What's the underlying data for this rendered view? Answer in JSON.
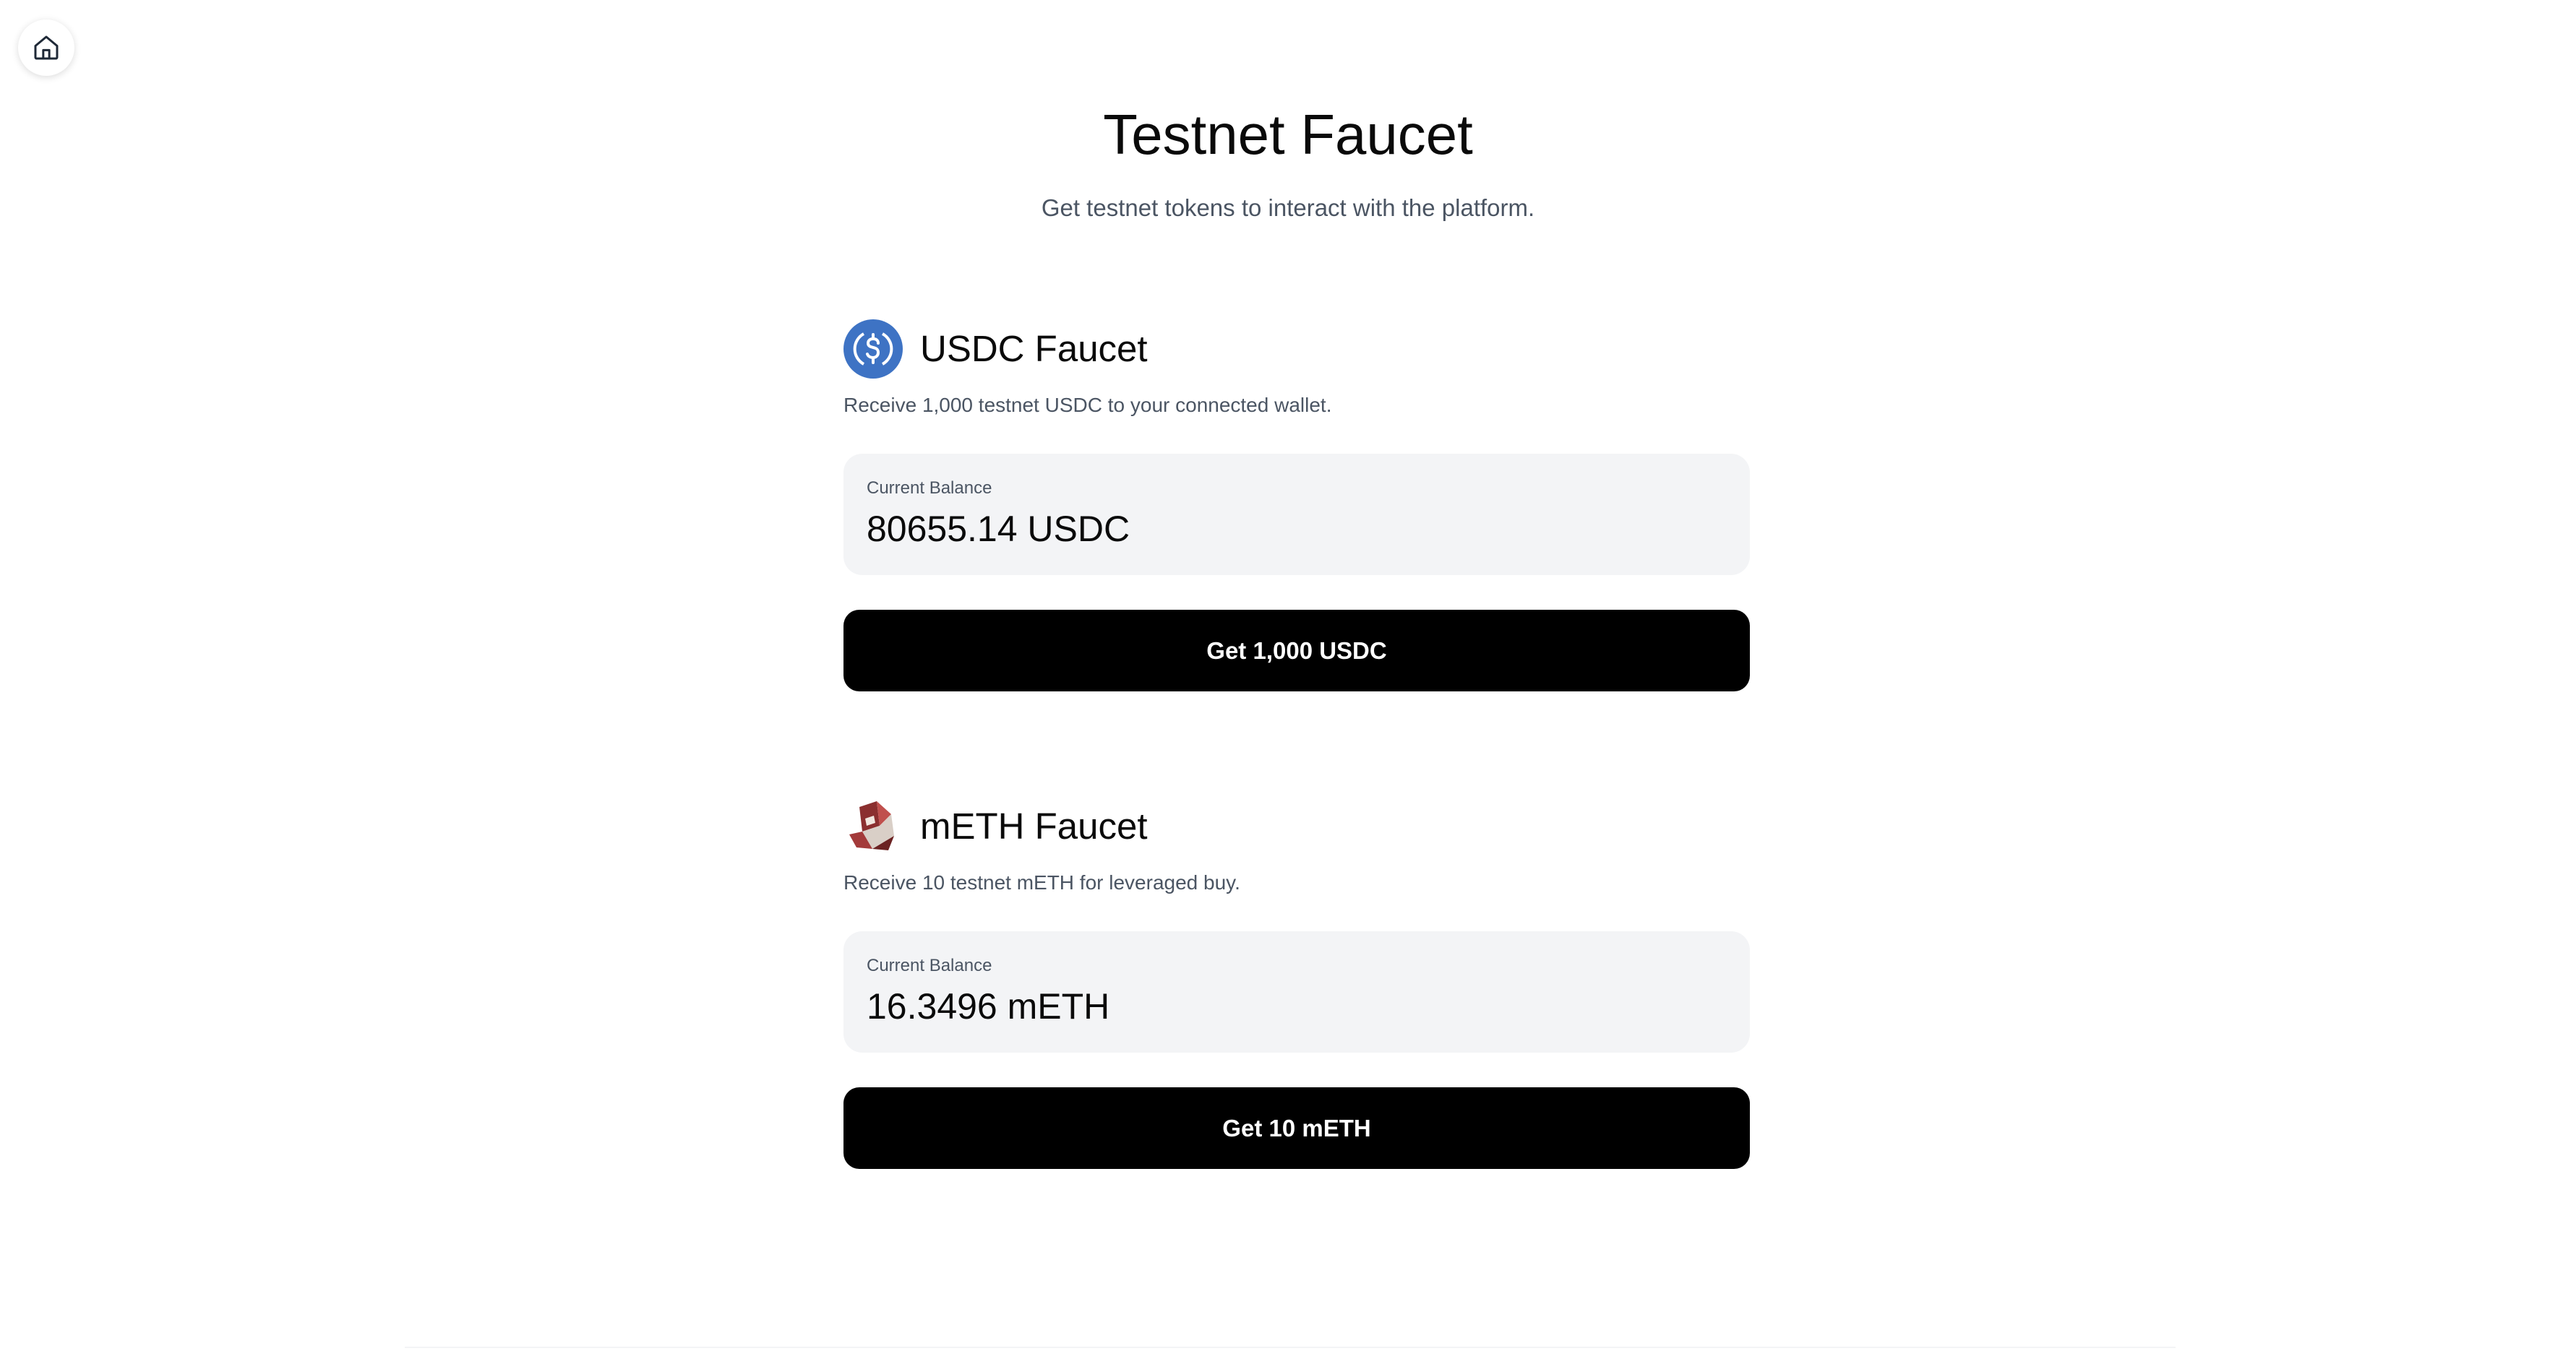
{
  "nav": {
    "home_icon": "home-icon"
  },
  "header": {
    "title": "Testnet Faucet",
    "subtitle": "Get testnet tokens to interact with the platform."
  },
  "faucets": [
    {
      "icon": "usdc-coin-icon",
      "title": "USDC Faucet",
      "description": "Receive 1,000 testnet USDC to your connected wallet.",
      "balance_label": "Current Balance",
      "balance_value": "80655.14 USDC",
      "button_label": "Get 1,000 USDC"
    },
    {
      "icon": "meth-token-icon",
      "title": "mETH Faucet",
      "description": "Receive 10 testnet mETH for leveraged buy.",
      "balance_label": "Current Balance",
      "balance_value": "16.3496 mETH",
      "button_label": "Get 10 mETH"
    }
  ],
  "colors": {
    "usdc_brand": "#3e73c4",
    "button_bg": "#000000",
    "card_bg": "#f3f4f6",
    "muted_text": "#4b5563"
  }
}
